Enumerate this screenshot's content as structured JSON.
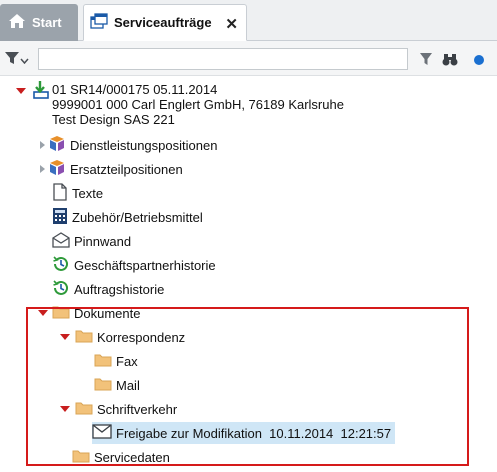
{
  "tabs": {
    "start_label": "Start",
    "service_label": "Serviceaufträge",
    "close_glyph": "✕"
  },
  "filter": {
    "search_value": "",
    "search_placeholder": ""
  },
  "tree": {
    "root": {
      "line1": "01 SR14/000175 05.11.2014",
      "line2": "9999001 000 Carl Englert GmbH, 76189 Karlsruhe",
      "line3": "Test Design SAS 221"
    },
    "items": [
      {
        "label": "Dienstleistungspositionen",
        "icon": "cubes-icon"
      },
      {
        "label": "Ersatzteilpositionen",
        "icon": "cubes-icon"
      },
      {
        "label": "Texte",
        "icon": "document-icon"
      },
      {
        "label": "Zubehör/Betriebsmittel",
        "icon": "calculator-icon"
      },
      {
        "label": "Pinnwand",
        "icon": "envelope-icon"
      },
      {
        "label": "Geschäftspartnerhistorie",
        "icon": "history-icon"
      },
      {
        "label": "Auftragshistorie",
        "icon": "history-icon"
      }
    ],
    "documents": {
      "label": "Dokumente",
      "korrespondenz": "Korrespondenz",
      "fax": "Fax",
      "mail": "Mail",
      "schriftverkehr": "Schriftverkehr",
      "selected_item": "Freigabe zur Modifikation  10.11.2014  12:21:57",
      "servicedaten": "Servicedaten"
    }
  },
  "colors": {
    "accent": "#1a6fd0",
    "expand_arrow": "#c81e1e",
    "highlight_border": "#d51a1a",
    "selection": "#cfe6f6",
    "folder": "#f2c27a"
  }
}
